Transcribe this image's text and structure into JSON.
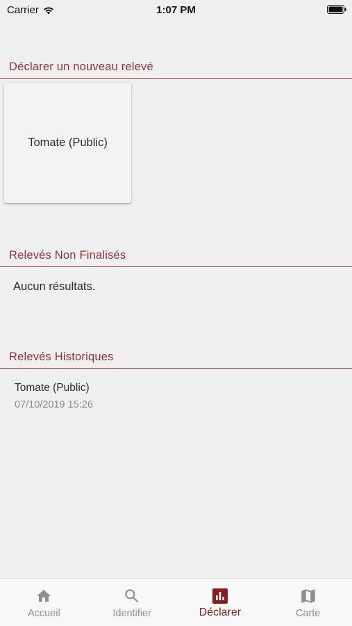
{
  "status_bar": {
    "carrier": "Carrier",
    "time": "1:07 PM"
  },
  "colors": {
    "accent": "#8b1a1d",
    "section_title": "#8a3539",
    "divider": "#a54a4c",
    "inactive_tab": "#8e8e93"
  },
  "sections": {
    "new_survey": {
      "title": "Déclarer un nouveau relevé"
    },
    "unfinished": {
      "title": "Relevés Non Finalisés",
      "empty_text": "Aucun résultats."
    },
    "history": {
      "title": "Relevés Historiques"
    }
  },
  "protocols": [
    {
      "label": "Tomate (Public)"
    }
  ],
  "history_items": [
    {
      "title": "Tomate (Public)",
      "date": "07/10/2019 15:26"
    }
  ],
  "tabs": [
    {
      "label": "Accueil",
      "icon": "home-icon",
      "active": false
    },
    {
      "label": "Identifier",
      "icon": "search-icon",
      "active": false
    },
    {
      "label": "Déclarer",
      "icon": "bar-chart-icon",
      "active": true
    },
    {
      "label": "Carte",
      "icon": "map-icon",
      "active": false
    }
  ]
}
